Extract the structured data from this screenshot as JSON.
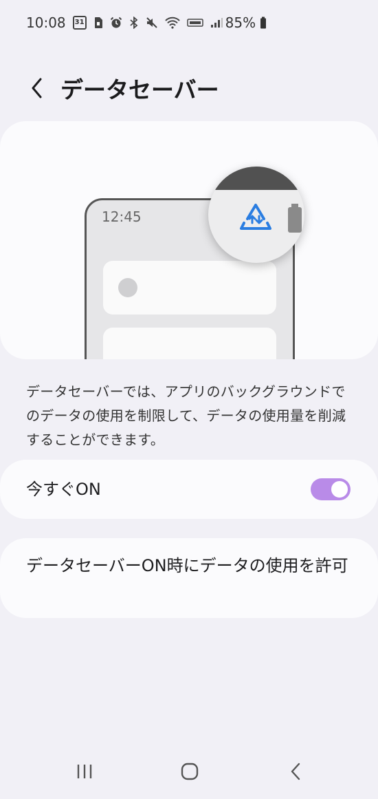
{
  "status_bar": {
    "time": "10:08",
    "calendar_day": "31",
    "battery_percent": "85%",
    "icons": [
      "calendar-icon",
      "sim-icon",
      "alarm-icon",
      "bluetooth-icon",
      "mute-icon",
      "wifi-icon",
      "volte-icon",
      "signal-icon",
      "battery-icon"
    ]
  },
  "header": {
    "title": "データセーバー"
  },
  "illustration": {
    "phone_time": "12:45",
    "accent_color": "#2a7de1"
  },
  "description": "データセーバーでは、アプリのバックグラウンドでのデータの使用を制限して、データの使用量を削減することができます。",
  "settings": {
    "turn_on_now": {
      "label": "今すぐON",
      "enabled": true,
      "toggle_color": "#b98be8"
    },
    "allow_data": {
      "label": "データセーバーON時にデータの使用を許可"
    }
  },
  "nav": {
    "icons": [
      "recent-apps-icon",
      "home-icon",
      "back-icon"
    ]
  }
}
